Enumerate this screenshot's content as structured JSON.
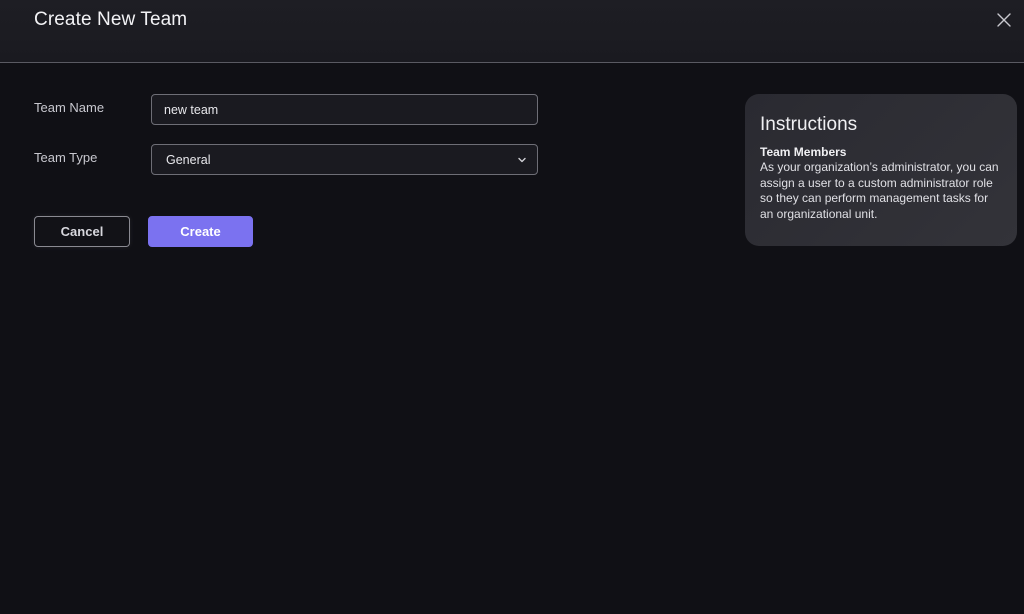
{
  "header": {
    "title": "Create New Team",
    "close_icon": "close-icon"
  },
  "form": {
    "team_name": {
      "label": "Team Name",
      "value": "new team",
      "placeholder": ""
    },
    "team_type": {
      "label": "Team Type",
      "selected": "General",
      "icon": "chevron-down-icon"
    }
  },
  "actions": {
    "cancel_label": "Cancel",
    "create_label": "Create"
  },
  "instructions": {
    "title": "Instructions",
    "subtitle": "Team Members",
    "body": "As your organization’s administrator, you can assign a user to a custom administrator role so they can perform management tasks for an organizational unit."
  },
  "colors": {
    "background": "#101015",
    "header_background": "#1e1e24",
    "accent": "#7b72f0",
    "panel_background": "#2e2e35"
  }
}
